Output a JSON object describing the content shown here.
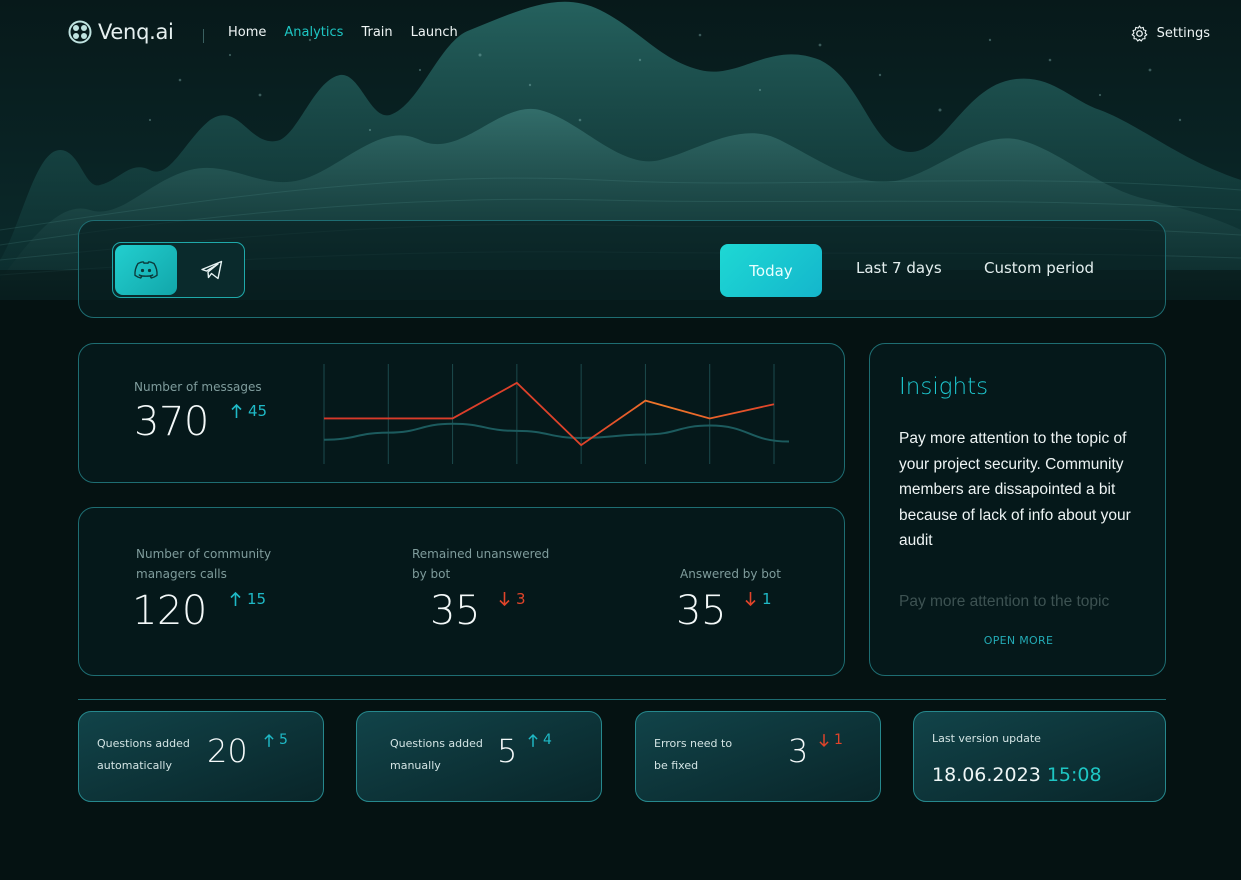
{
  "app": {
    "name": "Venq.ai"
  },
  "nav": {
    "items": [
      {
        "label": "Home",
        "active": false
      },
      {
        "label": "Analytics",
        "active": true
      },
      {
        "label": "Train",
        "active": false
      },
      {
        "label": "Launch",
        "active": false
      }
    ],
    "settings_label": "Settings"
  },
  "filters": {
    "channels": [
      {
        "icon": "discord-icon",
        "selected": true
      },
      {
        "icon": "telegram-icon",
        "selected": false
      }
    ],
    "periods": [
      {
        "label": "Today",
        "selected": true
      },
      {
        "label": "Last 7 days",
        "selected": false
      },
      {
        "label": "Custom period",
        "selected": false
      }
    ]
  },
  "messages": {
    "label": "Number of messages",
    "value": "370",
    "delta": "45",
    "trend": "up"
  },
  "chart_data": {
    "type": "line",
    "series": [
      {
        "values": [
          20,
          20,
          20,
          40,
          5,
          30,
          20,
          28
        ],
        "color": "#d6382a"
      },
      {
        "values": [
          8,
          12,
          17,
          13,
          9,
          11,
          16,
          7
        ],
        "color": "#1c5b5e"
      }
    ],
    "grid": true
  },
  "calls": {
    "managers": {
      "label_line1": "Number of community",
      "label_line2": "managers calls",
      "value": "120",
      "delta": "15",
      "trend": "up"
    },
    "unanswered": {
      "label_line1": "Remained unanswered",
      "label_line2": "by bot",
      "value": "35",
      "delta": "3",
      "trend": "down"
    },
    "answered": {
      "label": "Answered by bot",
      "value": "35",
      "delta": "1",
      "trend": "down"
    }
  },
  "insights": {
    "title": "Insights",
    "text": "Pay more attention to the topic of your project security. Community members are dissapointed a bit because of lack of info about your audit",
    "faded_text": "Pay more attention to the topic",
    "open_more": "OPEN MORE"
  },
  "stats": [
    {
      "label_line1": "Questions added",
      "label_line2": "automatically",
      "value": "20",
      "delta": "5",
      "trend": "up"
    },
    {
      "label_line1": "Questions added",
      "label_line2": "manually",
      "value": "5",
      "delta": "4",
      "trend": "up"
    },
    {
      "label_line1": "Errors need to",
      "label_line2": "be fixed",
      "value": "3",
      "delta": "1",
      "trend": "down"
    }
  ],
  "version": {
    "label": "Last version update",
    "date": "18.06.2023",
    "time": "15:08"
  },
  "colors": {
    "accent": "#1ec6c3",
    "up": "#1fb9c6",
    "down": "#e0442a",
    "background": "#051212"
  }
}
